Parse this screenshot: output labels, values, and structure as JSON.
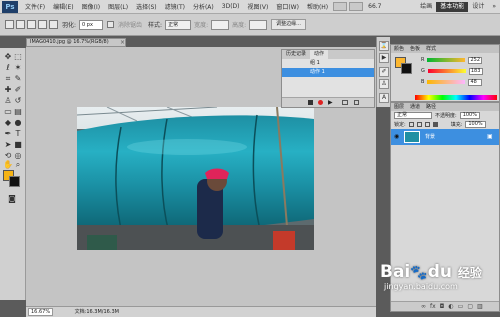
{
  "menubar": {
    "logo": "Ps",
    "items": [
      "文件(F)",
      "编辑(E)",
      "图像(I)",
      "图层(L)",
      "选择(S)",
      "滤镜(T)",
      "分析(A)",
      "3D(D)",
      "视图(V)",
      "窗口(W)",
      "帮助(H)"
    ],
    "zoom": "66.7",
    "workspace": [
      "绘画",
      "基本功能",
      "设计"
    ],
    "more": "»"
  },
  "options": {
    "feather_label": "羽化:",
    "feather_value": "0 px",
    "antialias_label": "消除锯齿",
    "style_label": "样式:",
    "style_value": "正常",
    "width_label": "宽度:",
    "height_label": "高度:",
    "refine_button": "调整边缘..."
  },
  "document": {
    "tab_title": "IMAG0410.jpg @ 16.7%(RGB/8)",
    "close": "×",
    "zoom_status": "16.67%",
    "file_info": "文档:16.3M/16.3M"
  },
  "float_panel": {
    "tabs": [
      "历史记录",
      "动作"
    ],
    "rows": [
      {
        "label": "组 1"
      },
      {
        "label": "动作 1"
      }
    ]
  },
  "color_panel": {
    "tabs": [
      "颜色",
      "色板",
      "样式"
    ],
    "sliders": [
      {
        "label": "R",
        "value": "252",
        "color": "#f05050"
      },
      {
        "label": "G",
        "value": "183",
        "color": "#50c050"
      },
      {
        "label": "B",
        "value": "48",
        "color": "#5070f0"
      }
    ],
    "foreground": "#fcb730",
    "background": "#111111"
  },
  "layers_panel": {
    "tabs": [
      "图层",
      "通道",
      "路径"
    ],
    "blend_mode": "正常",
    "opacity_label": "不透明度:",
    "opacity_value": "100%",
    "lock_label": "锁定:",
    "fill_label": "填充:",
    "fill_value": "100%",
    "layer_name": "背景"
  },
  "watermark": {
    "brand": "Bai",
    "brand2": "du",
    "sub": "经验",
    "url": "jingyan.baidu.com"
  }
}
